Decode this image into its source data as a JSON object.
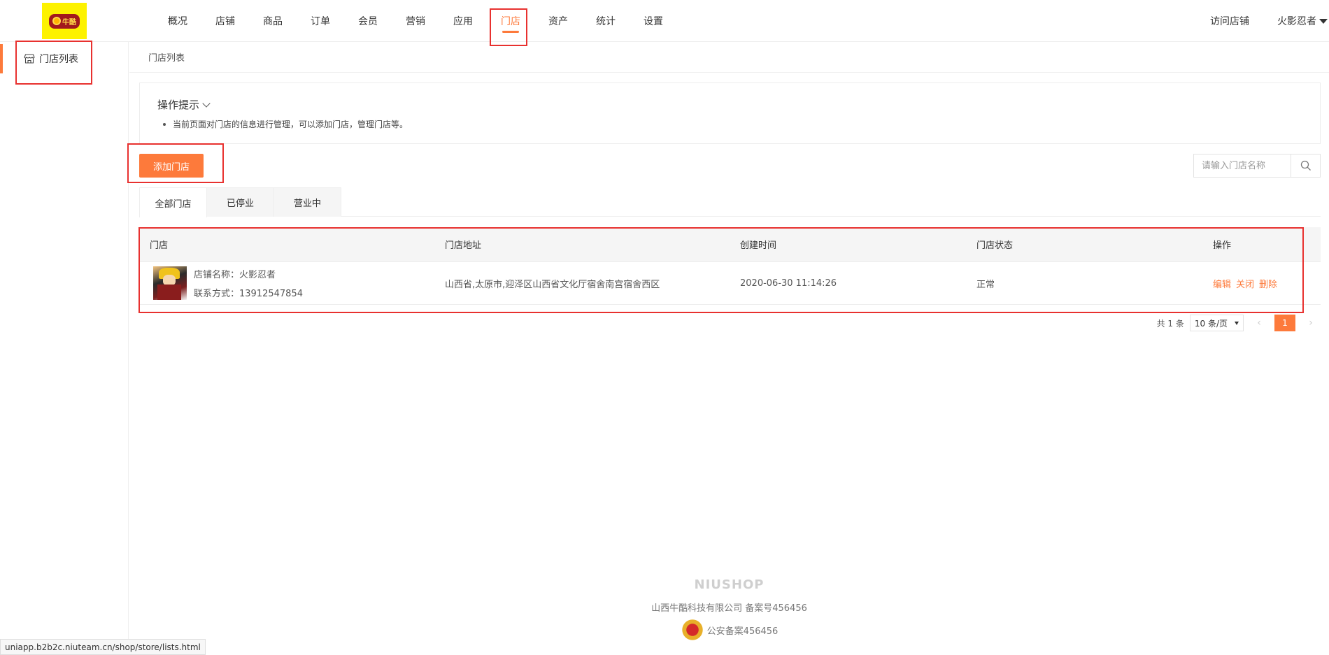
{
  "logo": {
    "text": "牛酷"
  },
  "nav": {
    "items": [
      {
        "label": "概况",
        "active": false
      },
      {
        "label": "店铺",
        "active": false
      },
      {
        "label": "商品",
        "active": false
      },
      {
        "label": "订单",
        "active": false
      },
      {
        "label": "会员",
        "active": false
      },
      {
        "label": "营销",
        "active": false
      },
      {
        "label": "应用",
        "active": false
      },
      {
        "label": "门店",
        "active": true
      },
      {
        "label": "资产",
        "active": false
      },
      {
        "label": "统计",
        "active": false
      },
      {
        "label": "设置",
        "active": false
      }
    ],
    "visit_store": "访问店铺",
    "username": "火影忍者"
  },
  "sidebar": {
    "items": [
      {
        "label": "门店列表",
        "icon": "store-icon",
        "active": true
      }
    ]
  },
  "breadcrumb": "门店列表",
  "tips": {
    "title": "操作提示",
    "text": "当前页面对门店的信息进行管理，可以添加门店，管理门店等。"
  },
  "toolbar": {
    "add_label": "添加门店",
    "search_placeholder": "请输入门店名称"
  },
  "tabs": [
    {
      "label": "全部门店",
      "active": true
    },
    {
      "label": "已停业",
      "active": false
    },
    {
      "label": "营业中",
      "active": false
    }
  ],
  "table": {
    "headers": [
      "门店",
      "门店地址",
      "创建时间",
      "门店状态",
      "操作"
    ],
    "rows": [
      {
        "name_line": "店铺名称：火影忍者",
        "contact_line": "联系方式：13912547854",
        "address": "山西省,太原市,迎泽区山西省文化厅宿舍南宫宿舍西区",
        "created": "2020-06-30 11:14:26",
        "status": "正常",
        "actions": [
          "编辑",
          "关闭",
          "删除"
        ]
      }
    ]
  },
  "pagination": {
    "total": "共 1 条",
    "page_size": "10 条/页",
    "current": "1"
  },
  "footer": {
    "brand": "NIUSHOP",
    "company": "山西牛酷科技有限公司  备案号456456",
    "police": "公安备案456456"
  },
  "status_url": "uniapp.b2b2c.niuteam.cn/shop/store/lists.html",
  "colors": {
    "accent": "#fd7a3b",
    "highlight": "#e8312f",
    "logo_bg": "#fdf200"
  }
}
